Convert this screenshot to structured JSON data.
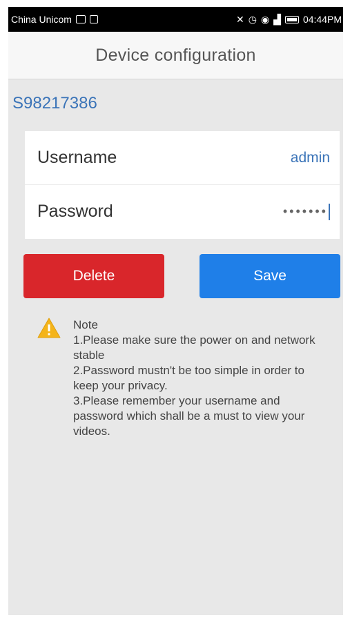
{
  "status_bar": {
    "carrier": "China Unicom",
    "time": "04:44PM"
  },
  "header": {
    "title": "Device configuration"
  },
  "device": {
    "id": "S98217386"
  },
  "form": {
    "username_label": "Username",
    "username_value": "admin",
    "password_label": "Password",
    "password_value": "•••••••"
  },
  "actions": {
    "delete_label": "Delete",
    "save_label": "Save"
  },
  "note": {
    "heading": "Note",
    "items": [
      "1.Please make sure the power on and network stable",
      "2.Password mustn't be too simple in order to keep your privacy.",
      "3.Please remember your username and password which shall be a must to view your videos."
    ]
  },
  "colors": {
    "accent_blue": "#1f7fe8",
    "danger_red": "#d9262b",
    "link_blue": "#3b74b8",
    "warning_yellow": "#f4b41a"
  },
  "icons": [
    "image-icon",
    "notification-icon",
    "mute-icon",
    "alarm-icon",
    "wifi-icon",
    "signal-icon",
    "battery-icon",
    "warning-icon"
  ]
}
